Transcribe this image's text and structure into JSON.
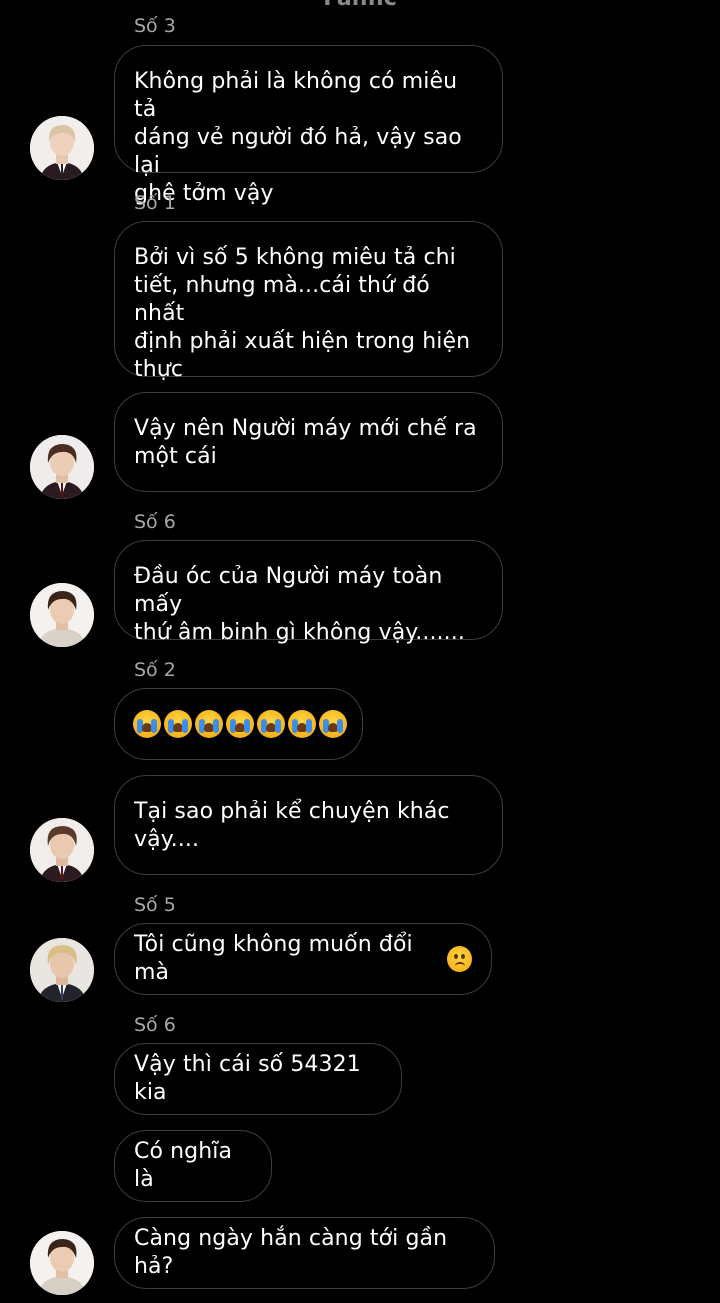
{
  "header": {
    "title": "Fanfic"
  },
  "messages": [
    {
      "sender": "Số 3",
      "text": "Không phải là không có miêu tả\ndáng vẻ người đó hả, vậy sao lại\nghê tởm vậy",
      "avatar": "boy-portrait-light-hair"
    },
    {
      "sender": "Số 1",
      "text": "Bởi vì số 5 không miêu tả chi\ntiết, nhưng mà...cái thứ đó nhất\nđịnh phải xuất hiện trong hiện\nthực",
      "avatar": ""
    },
    {
      "sender": "",
      "text": "Vậy nên Người máy mới chế ra\nmột cái",
      "avatar": "boy-portrait-brown-hair"
    },
    {
      "sender": "Số 6",
      "text": "Đầu óc của Người máy toàn mấy\nthứ âm binh gì không vậy.......",
      "avatar": "boy-portrait-sweater"
    },
    {
      "sender": "Số 2",
      "text": "",
      "emoji": "loudly-crying-face-x7",
      "avatar": ""
    },
    {
      "sender": "",
      "text": "Tại sao phải kể chuyện khác\nvậy....",
      "avatar": "boy-portrait-dark-hair"
    },
    {
      "sender": "Số 5",
      "text": "Tôi cũng không muốn đổi mà",
      "emoji": "sad-face",
      "avatar": "boy-portrait-blonde-suit"
    },
    {
      "sender": "Số 6",
      "text": "Vậy thì cái số 54321 kia",
      "avatar": ""
    },
    {
      "sender": "",
      "text": "Có nghĩa là",
      "avatar": ""
    },
    {
      "sender": "",
      "text": "Càng ngày hắn càng tới gần hả?",
      "avatar": "boy-portrait-sweater"
    }
  ],
  "colors": {
    "background": "#000000",
    "bubble_border": "#3c3c3c",
    "sender_text": "#a8a8a8",
    "message_text": "#ffffff"
  }
}
